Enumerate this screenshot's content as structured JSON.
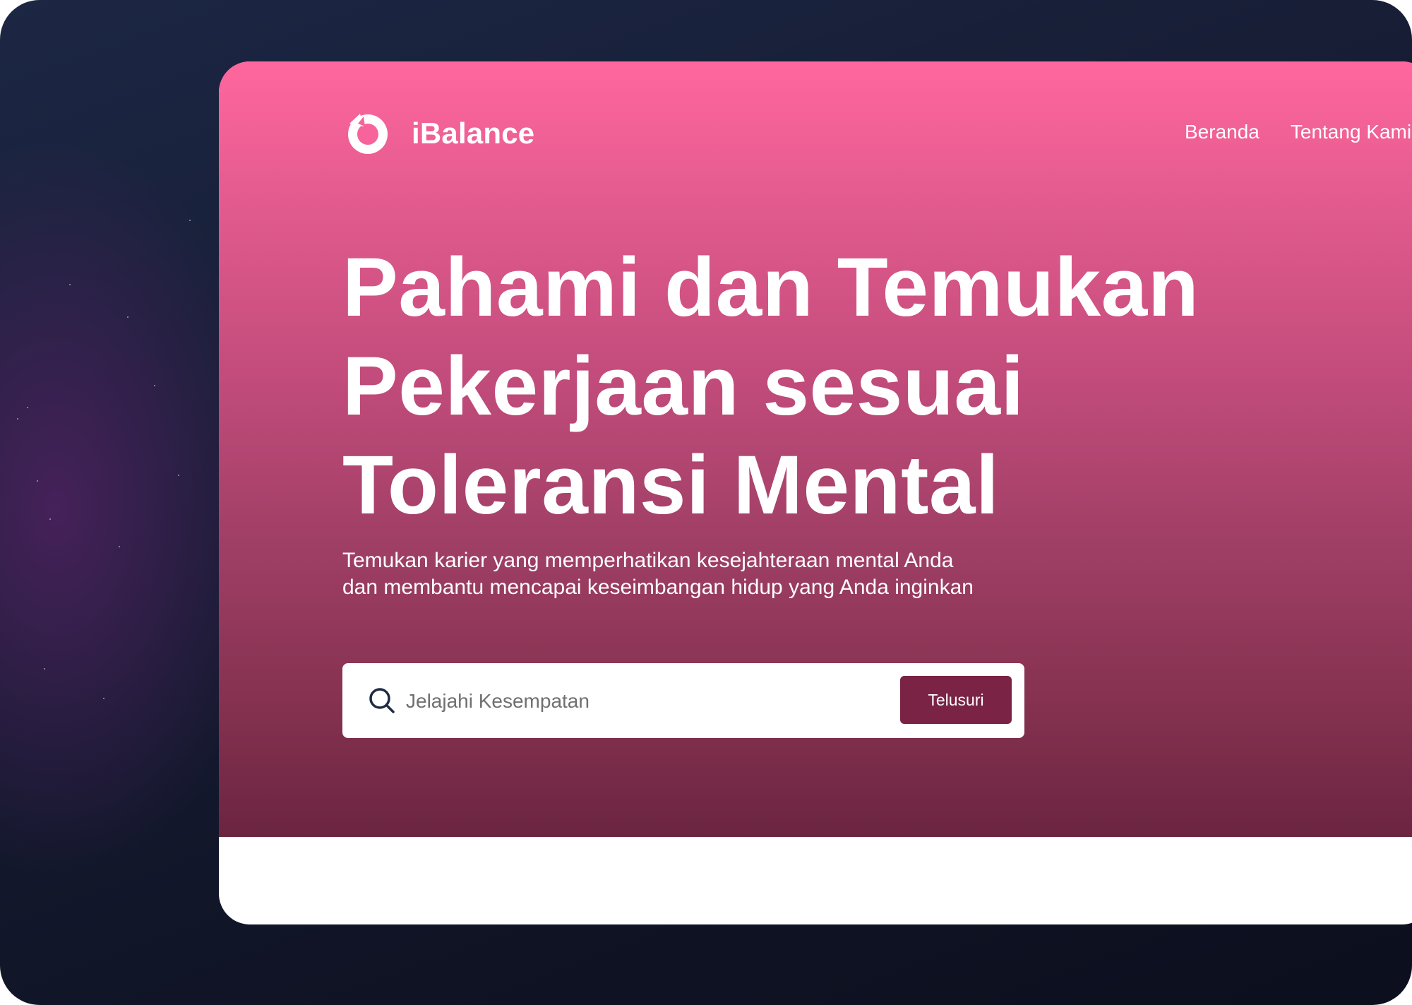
{
  "app": {
    "brand": "iBalance"
  },
  "nav": {
    "items": [
      {
        "label": "Beranda"
      },
      {
        "label": "Tentang Kami"
      }
    ]
  },
  "hero": {
    "headline_lines": [
      "Pahami dan Temukan",
      "Pekerjaan sesuai",
      "Toleransi Mental"
    ],
    "subtitle_lines": [
      "Temukan karier yang memperhatikan kesejahteraan mental Anda",
      "dan membantu mencapai keseimbangan hidup yang Anda inginkan"
    ]
  },
  "search": {
    "placeholder": "Jelajahi Kesempatan",
    "value": "",
    "button_label": "Telusuri",
    "icon": "search-icon"
  },
  "colors": {
    "hero_top": "#ff679e",
    "hero_bottom": "#6b2541",
    "button": "#7a2344",
    "backdrop": "#161c33"
  }
}
